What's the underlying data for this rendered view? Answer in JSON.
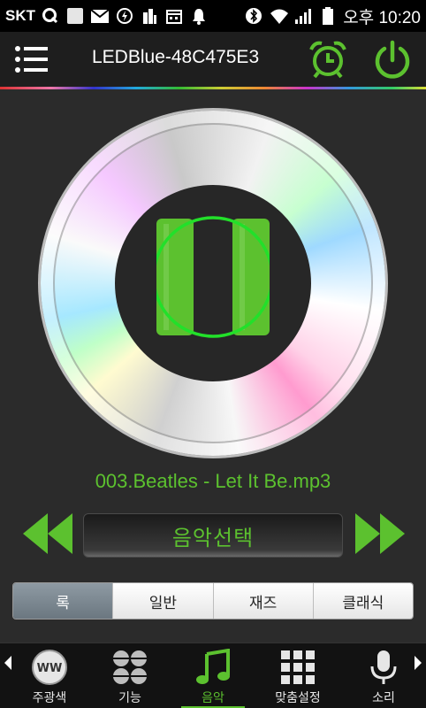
{
  "status_bar": {
    "carrier": "SKT",
    "time": "오후 10:20"
  },
  "header": {
    "device_name": "LEDBlue-48C475E3"
  },
  "player": {
    "track_name": "003.Beatles - Let It Be.mp3",
    "select_music_label": "음악선택",
    "state": "playing"
  },
  "genres": [
    {
      "label": "록",
      "active": true
    },
    {
      "label": "일반",
      "active": false
    },
    {
      "label": "재즈",
      "active": false
    },
    {
      "label": "클래식",
      "active": false
    }
  ],
  "bottom_nav": {
    "items": [
      {
        "label": "주광색",
        "icon": "ww-icon",
        "badge": "WW"
      },
      {
        "label": "기능",
        "icon": "function-grid-icon"
      },
      {
        "label": "음악",
        "icon": "music-note-icon",
        "active": true
      },
      {
        "label": "맞춤설정",
        "icon": "custom-grid-icon"
      },
      {
        "label": "소리",
        "icon": "microphone-icon"
      }
    ]
  },
  "colors": {
    "accent": "#5cc12f",
    "background": "#2b2b2b",
    "header": "#1e1e1e"
  }
}
